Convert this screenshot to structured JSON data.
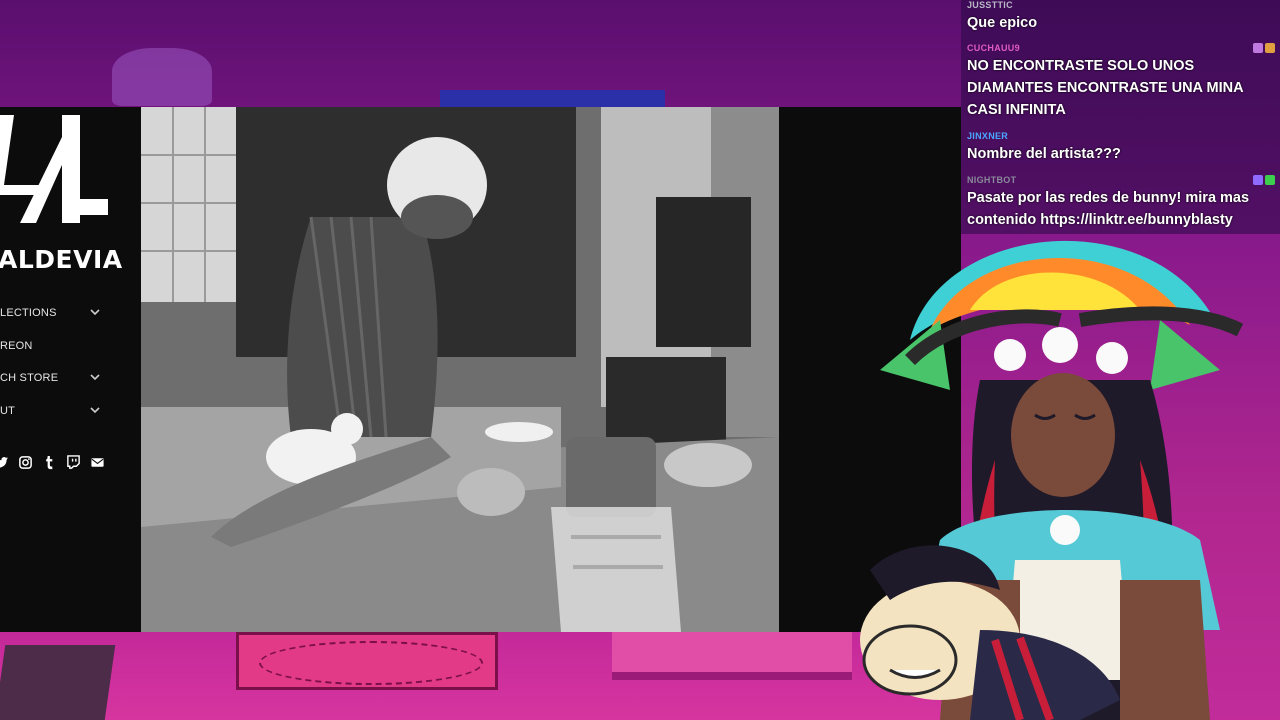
{
  "website": {
    "logo_text": "ALDEVIA",
    "nav": [
      {
        "label": "LECTIONS",
        "has_submenu": true
      },
      {
        "label": "REON",
        "has_submenu": false
      },
      {
        "label": "CH STORE",
        "has_submenu": true
      },
      {
        "label": "UT",
        "has_submenu": true
      }
    ],
    "socials": [
      "twitter-icon",
      "instagram-icon",
      "tumblr-icon",
      "twitch-icon",
      "mail-icon"
    ]
  },
  "chat": {
    "messages": [
      {
        "user": "JUSSTTIC",
        "text": "Que epico",
        "user_color": "#b9b9c6",
        "badges": []
      },
      {
        "user": "CUCHAUU9",
        "text": "NO ENCONTRASTE SOLO UNOS DIAMANTES ENCONTRASTE UNA MINA CASI INFINITA",
        "user_color": "#e05ac4",
        "badges": [
          "#c07adf",
          "#e0a040"
        ]
      },
      {
        "user": "JINXNER",
        "text": "Nombre del artista???",
        "user_color": "#4aa6ff",
        "badges": []
      },
      {
        "user": "NIGHTBOT",
        "text": "Pasate por las redes de bunny! mira mas contenido https://linktr.ee/bunnyblasty",
        "user_color": "#8a8a9a",
        "badges": [
          "#8f6cff",
          "#3ccf4e"
        ]
      }
    ]
  },
  "colors": {
    "background": "#8a1a8c",
    "site_bg": "#0c0c0c"
  }
}
